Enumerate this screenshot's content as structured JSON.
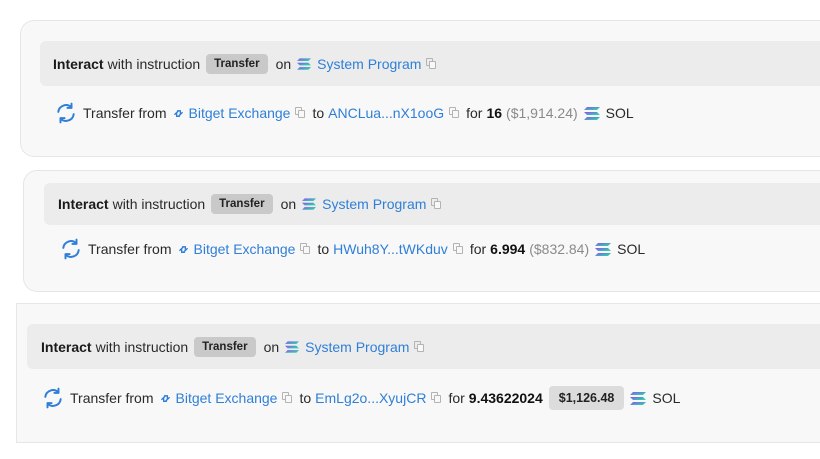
{
  "instructions": [
    {
      "interact_label": "Interact",
      "with_text": "with instruction",
      "chip": "Transfer",
      "on_text": "on",
      "program": "System Program",
      "transfer_label": "Transfer from",
      "from": "Bitget Exchange",
      "to_text": "to",
      "to": "ANCLua...nX1ooG",
      "for_text": "for",
      "amount": "16",
      "usd": "($1,914.24)",
      "token": "SOL"
    },
    {
      "interact_label": "Interact",
      "with_text": "with instruction",
      "chip": "Transfer",
      "on_text": "on",
      "program": "System Program",
      "transfer_label": "Transfer from",
      "from": "Bitget Exchange",
      "to_text": "to",
      "to": "HWuh8Y...tWKduv",
      "for_text": "for",
      "amount": "6.994",
      "usd": "($832.84)",
      "token": "SOL"
    },
    {
      "interact_label": "Interact",
      "with_text": "with instruction",
      "chip": "Transfer",
      "on_text": "on",
      "program": "System Program",
      "transfer_label": "Transfer from",
      "from": "Bitget Exchange",
      "to_text": "to",
      "to": "EmLg2o...XyujCR",
      "for_text": "for",
      "amount": "9.43622024",
      "usd": "$1,126.48",
      "token": "SOL"
    }
  ],
  "colors": {
    "link": "#2f7fd8",
    "chip_bg": "#c9c9c9",
    "card_bg": "#f8f8f8",
    "header_bg": "#ececec"
  },
  "icons": [
    "transfer-icon",
    "solana-icon",
    "copy-icon",
    "link-icon"
  ]
}
